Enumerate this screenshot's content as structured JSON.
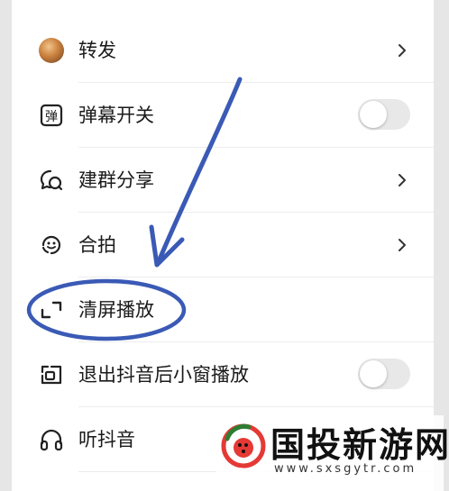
{
  "menu": {
    "items": [
      {
        "label": "转发",
        "icon": "user-avatar",
        "control": "chevron"
      },
      {
        "label": "弹幕开关",
        "icon": "danmaku-icon",
        "control": "toggle",
        "toggle_on": false
      },
      {
        "label": "建群分享",
        "icon": "group-chat-icon",
        "control": "chevron"
      },
      {
        "label": "合拍",
        "icon": "duet-icon",
        "control": "chevron"
      },
      {
        "label": "清屏播放",
        "icon": "clear-screen-icon",
        "control": "none"
      },
      {
        "label": "退出抖音后小窗播放",
        "icon": "mini-window-icon",
        "control": "toggle",
        "toggle_on": false
      },
      {
        "label": "听抖音",
        "icon": "headphones-icon",
        "control": "none"
      }
    ]
  },
  "annotation": {
    "color": "#3a5ab5",
    "highlighted_item": "清屏播放"
  },
  "watermark": {
    "title": "国投新游网",
    "url": "www.sxsgytr.com"
  },
  "colors": {
    "background": "#ffffff",
    "text": "#1a1a1a",
    "toggle_off": "#e8e8e8",
    "divider": "#ededed"
  }
}
